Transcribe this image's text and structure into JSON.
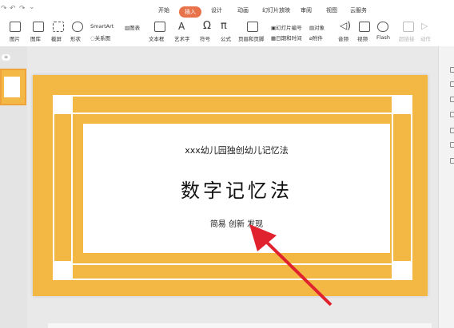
{
  "menu": {
    "tabs": [
      "开始",
      "插入",
      "设计",
      "动画",
      "幻灯片放映",
      "审阅",
      "视图",
      "云服务"
    ],
    "active_tab": "插入"
  },
  "ribbon": {
    "picture": "图片",
    "gallery": "图库",
    "screenshot": "截屏",
    "shape": "形状",
    "smartart": "SmartArt",
    "chart": "图表",
    "relation": "关系图",
    "textbox": "文本框",
    "wordart": "艺术字",
    "symbol": "符号",
    "formula": "公式",
    "header_footer": "页眉和页脚",
    "slide_number": "幻灯片编号",
    "object": "对象",
    "date_time": "日期和时间",
    "attachment": "附件",
    "audio": "音频",
    "video": "视频",
    "flash": "Flash",
    "hyperlink": "超链接",
    "action": "动作"
  },
  "slide": {
    "subtitle": "xxx幼儿园独创幼儿记忆法",
    "title": "数字记忆法",
    "tagline": "简易 创新 发现"
  },
  "colors": {
    "accent": "#e8734a",
    "slide_bg": "#f3b744",
    "arrow": "#e0222e"
  }
}
